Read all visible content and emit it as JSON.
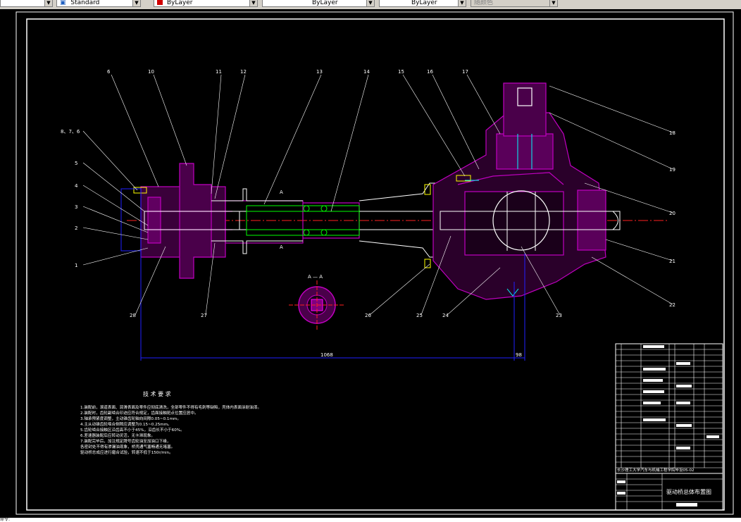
{
  "toolbar": {
    "textstyle": "Standard",
    "layer_color": "ByLayer",
    "linetype": "ByLayer",
    "lineweight": "ByLayer",
    "plotstyle": "随颜色"
  },
  "drawing": {
    "part_labels": [
      "6",
      "10",
      "11",
      "12",
      "13",
      "14",
      "15",
      "16",
      "17",
      "18",
      "19",
      "20",
      "21",
      "22",
      "23",
      "24",
      "25",
      "26",
      "27",
      "28",
      "1",
      "2",
      "3",
      "4",
      "5",
      "8、7、6"
    ],
    "section_label": "A — A",
    "section_mark": "A",
    "dim_main": "1068",
    "dim_side": "98",
    "tech_title": "技 术 要 求",
    "tech_lines": [
      "1.装配前，滚道表面、润滑表面及零件应彻底清洗，全部零件不得有毛刺等缺陷，壳体内表面涂耐油漆。",
      "2.装配时，齿轮副啮合印迹应符合规定，齿面接触斑点位置应居中。",
      "3.轴承预紧度调整，主动锥齿轮轴向间隙0.05~0.1mm。",
      "4.主从动锥齿轮啮合侧隙应调整为0.15~0.25mm。",
      "5.齿轮啮合接触区沿齿高不小于45%，沿齿长不小于60%。",
      "6.差速器装配后应转动灵活，无卡滞现象。",
      "7.装配完毕后，加注规定牌号齿轮油至加油口下缘，",
      "  各密封处不得有渗漏油现象，桥壳通气塞畅通无堵塞。",
      "  驱动桥总成应进行磨合试验，转速不低于150r/min。"
    ],
    "title_school": "长沙理工大学汽车与机械工程学院毕设05-02",
    "title_name": "驱动桥总体布置图"
  },
  "colors": {
    "purple": "#c000c0",
    "green": "#00ff00",
    "blue": "#2020ff",
    "red": "#ff2020",
    "cyan": "#00ffff",
    "yellow": "#ffff00"
  },
  "cmdline": "命令:"
}
